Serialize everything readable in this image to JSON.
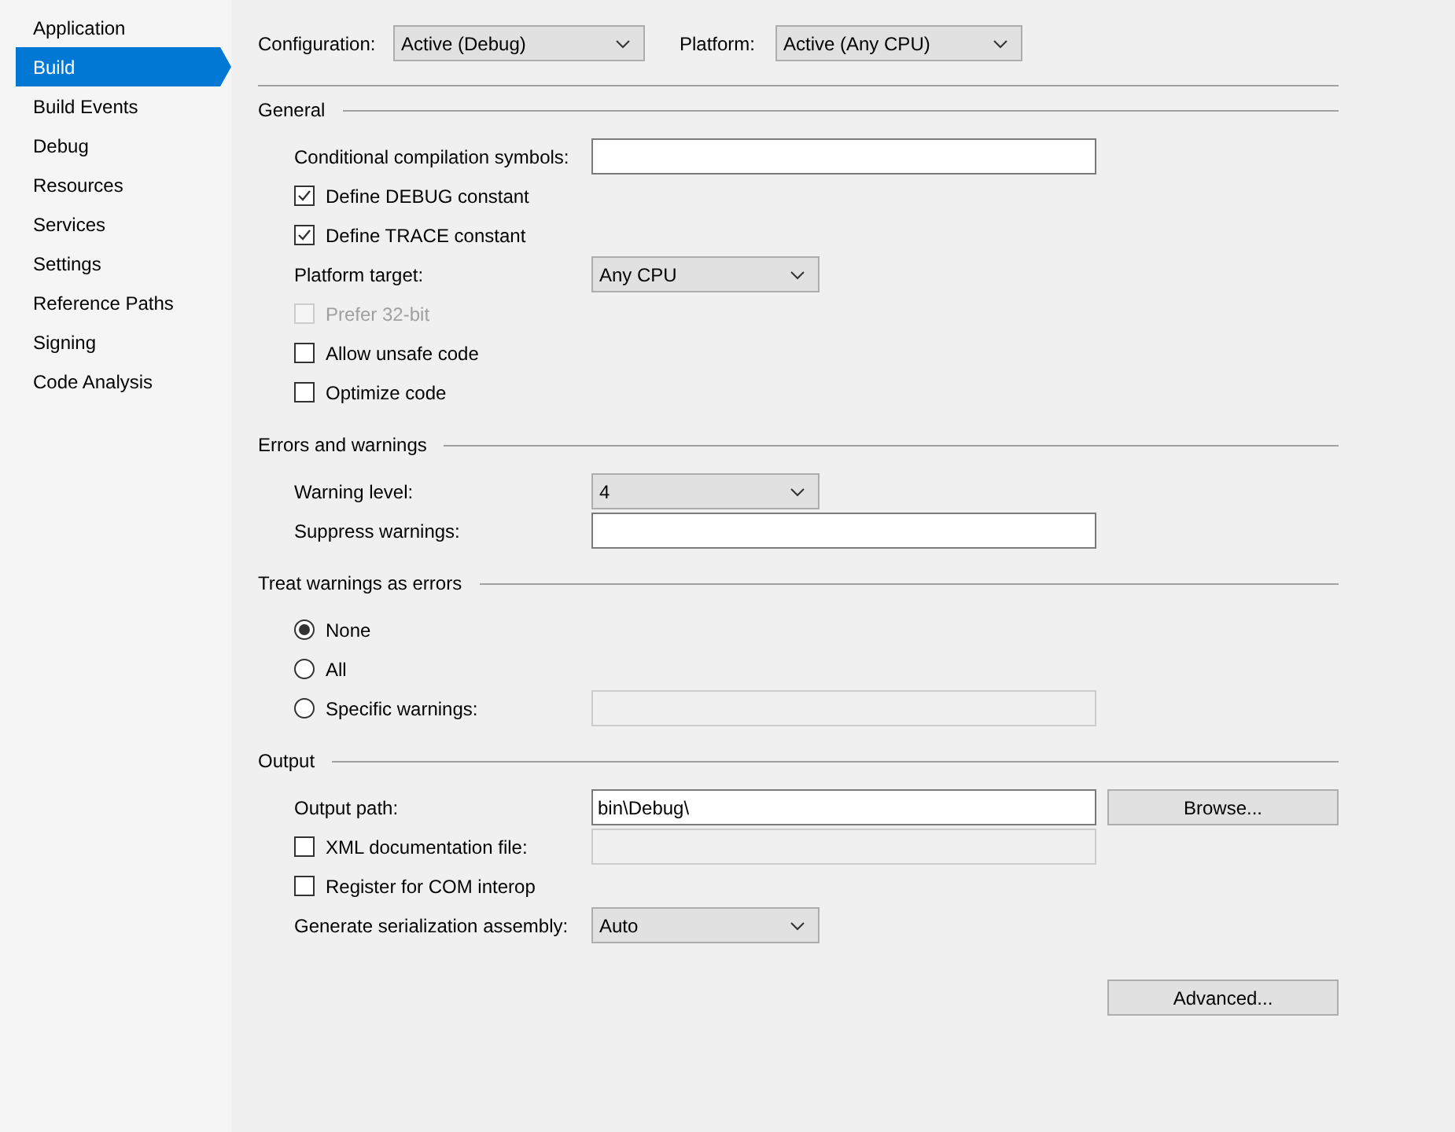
{
  "sidebar": {
    "items": [
      {
        "label": "Application",
        "selected": false
      },
      {
        "label": "Build",
        "selected": true
      },
      {
        "label": "Build Events",
        "selected": false
      },
      {
        "label": "Debug",
        "selected": false
      },
      {
        "label": "Resources",
        "selected": false
      },
      {
        "label": "Services",
        "selected": false
      },
      {
        "label": "Settings",
        "selected": false
      },
      {
        "label": "Reference Paths",
        "selected": false
      },
      {
        "label": "Signing",
        "selected": false
      },
      {
        "label": "Code Analysis",
        "selected": false
      }
    ]
  },
  "top": {
    "configuration": {
      "label": "Configuration:",
      "value": "Active (Debug)"
    },
    "platform": {
      "label": "Platform:",
      "value": "Active (Any CPU)"
    }
  },
  "sections": [
    {
      "title": "General",
      "rows": [
        {
          "kind": "text",
          "label": "Conditional compilation symbols:",
          "disabled": false
        },
        {
          "kind": "checkbox",
          "label": "Define DEBUG constant",
          "checked": true,
          "disabled": false
        },
        {
          "kind": "checkbox",
          "label": "Define TRACE constant",
          "checked": true,
          "disabled": false
        },
        {
          "kind": "combo",
          "label": "Platform target:",
          "value": "Any CPU"
        },
        {
          "kind": "checkbox",
          "label": "Prefer 32-bit",
          "checked": false,
          "disabled": true
        },
        {
          "kind": "checkbox",
          "label": "Allow unsafe code",
          "checked": false,
          "disabled": false
        },
        {
          "kind": "checkbox",
          "label": "Optimize code",
          "checked": false,
          "disabled": false
        }
      ]
    },
    {
      "title": "Errors and warnings",
      "rows": [
        {
          "kind": "combo",
          "label": "Warning level:",
          "value": "4"
        },
        {
          "kind": "text",
          "label": "Suppress warnings:",
          "disabled": false
        }
      ]
    },
    {
      "title": "Treat warnings as errors",
      "rows": [
        {
          "kind": "radio",
          "label": "None",
          "selected": true
        },
        {
          "kind": "radio",
          "label": "All",
          "selected": false
        },
        {
          "kind": "radio",
          "label": "Specific warnings:",
          "selected": false,
          "field": {
            "disabled": true
          }
        }
      ]
    },
    {
      "title": "Output",
      "rows": [
        {
          "kind": "text",
          "label": "Output path:",
          "value": "bin\\Debug\\",
          "disabled": false,
          "button": "Browse..."
        },
        {
          "kind": "checkbox",
          "label": "XML documentation file:",
          "checked": false,
          "disabled": false,
          "field": {
            "disabled": true
          }
        },
        {
          "kind": "checkbox",
          "label": "Register for COM interop",
          "checked": false,
          "disabled": false
        },
        {
          "kind": "combo",
          "label": "Generate serialization assembly:",
          "value": "Auto"
        }
      ]
    }
  ],
  "advanced_button": "Advanced..."
}
